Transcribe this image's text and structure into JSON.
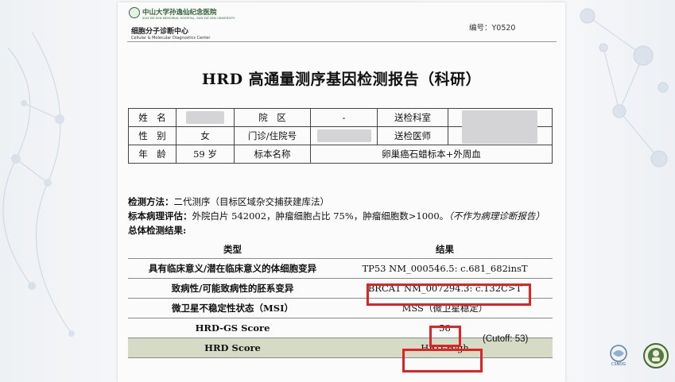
{
  "hospital": {
    "name": "中山大学孙逸仙纪念医院",
    "name_en": "SUN YAT-SEN MEMORIAL HOSPITAL, SUN YAT-SEN UNIVERSITY",
    "center": "细胞分子诊断中心",
    "center_en": "Cellular & Molecular Diagnostics Center"
  },
  "serial": "编号：Y0520",
  "title": "HRD 高通量测序基因检测报告（科研）",
  "patient": {
    "name_label": "姓　名",
    "ward_label": "院　区",
    "ward_value": "-",
    "dept_label": "送检科室",
    "sex_label": "性　别",
    "sex_value": "女",
    "clinic_label": "门诊/住院号",
    "doctor_label": "送检医师",
    "age_label": "年　龄",
    "age_value": "59 岁",
    "specimen_label": "标本名称",
    "specimen_value": "卵巢癌石蜡标本+外周血"
  },
  "method": {
    "label": "检测方法：",
    "value": "二代测序（目标区域杂交捕获建库法）",
    "path_label": "标本病理评估：",
    "path_value": "外院白片 542002，肿瘤细胞占比 75%，肿瘤细胞数>1000。",
    "path_note": "（不作为病理诊断报告）",
    "overall_label": "总体检测结果:"
  },
  "results": {
    "col_type": "类型",
    "col_result": "结果",
    "rows": [
      {
        "type": "具有临床意义/潜在临床意义的体细胞变异",
        "result": "TP53 NM_000546.5: c.681_682insT"
      },
      {
        "type": "致病性/可能致病性的胚系变异",
        "result": "BRCA1 NM_007294.3: c.132C>T"
      },
      {
        "type": "微卫星不稳定性状态（MSI）",
        "result": "MSS（微卫星稳定）"
      },
      {
        "type": "HRD-GS Score",
        "result": "58"
      },
      {
        "type": "HRD Score",
        "result": "HRD-High"
      }
    ],
    "cutoff_note": "(Cutoff: 53)"
  },
  "colors": {
    "highlight": "#e02424",
    "last_row_bg": "#d6dbc5",
    "hospital_green": "#2e5f34"
  }
}
